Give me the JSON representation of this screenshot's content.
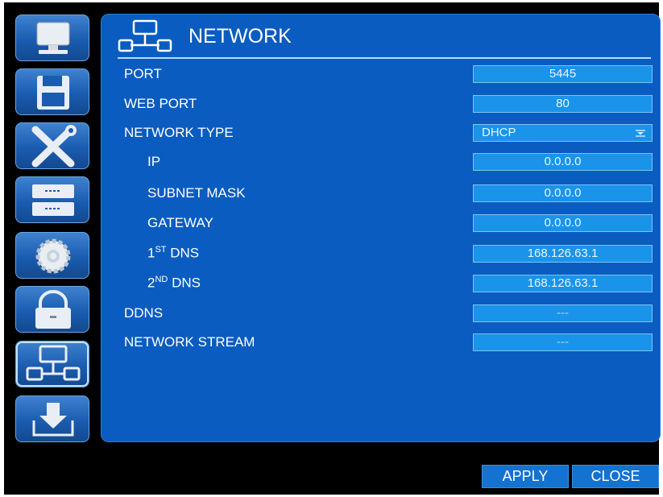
{
  "sidebar": {
    "items": [
      {
        "name": "display",
        "icon": "monitor-icon"
      },
      {
        "name": "record",
        "icon": "floppy-disk-icon"
      },
      {
        "name": "tools",
        "icon": "tools-icon"
      },
      {
        "name": "storage",
        "icon": "hard-drive-icon"
      },
      {
        "name": "system",
        "icon": "gear-icon"
      },
      {
        "name": "security",
        "icon": "lock-icon"
      },
      {
        "name": "network",
        "icon": "network-icon",
        "active": true
      },
      {
        "name": "backup",
        "icon": "download-icon"
      }
    ]
  },
  "panel": {
    "title": "NETWORK",
    "icon": "network-icon"
  },
  "settings": {
    "port": {
      "label": "PORT",
      "value": "5445"
    },
    "web_port": {
      "label": "WEB PORT",
      "value": "80"
    },
    "network_type": {
      "label": "NETWORK TYPE",
      "value": "DHCP"
    },
    "ip": {
      "label": "IP",
      "value": "0.0.0.0"
    },
    "subnet_mask": {
      "label": "SUBNET MASK",
      "value": "0.0.0.0"
    },
    "gateway": {
      "label": "GATEWAY",
      "value": "0.0.0.0"
    },
    "dns1": {
      "label_num": "1",
      "label_sup": "ST",
      "label_rest": " DNS",
      "value": "168.126.63.1"
    },
    "dns2": {
      "label_num": "2",
      "label_sup": "ND",
      "label_rest": " DNS",
      "value": "168.126.63.1"
    },
    "ddns": {
      "label": "DDNS",
      "value": "---"
    },
    "network_stream": {
      "label": "NETWORK STREAM",
      "value": "---"
    }
  },
  "buttons": {
    "apply": "APPLY",
    "close": "CLOSE"
  },
  "colors": {
    "panel_bg": "#0a5cc0",
    "field_bg": "#1994ea",
    "screen_bg": "#000000"
  }
}
